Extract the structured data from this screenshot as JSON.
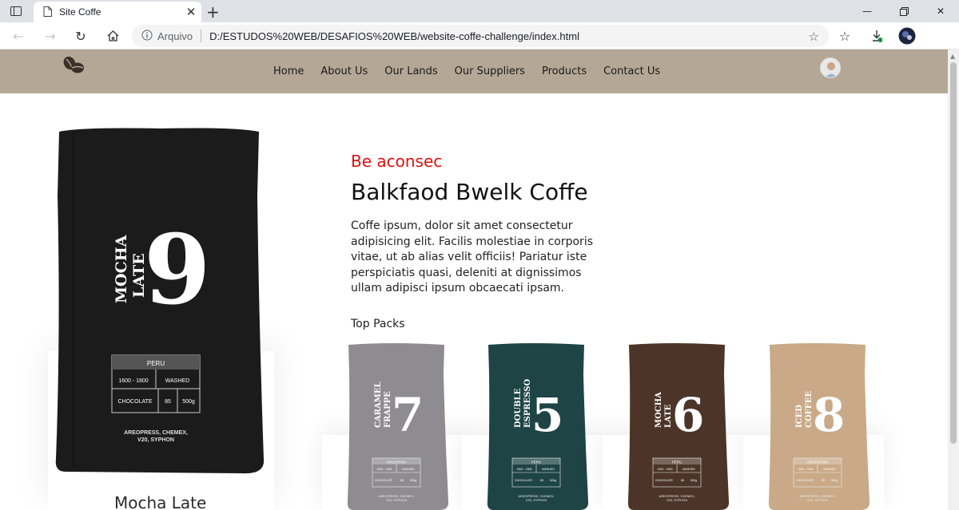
{
  "browser": {
    "tab_title": "Site Coffe",
    "url_label": "Arquivo",
    "url": "D:/ESTUDOS%20WEB/DESAFIOS%20WEB/website-coffe-challenge/index.html"
  },
  "nav": {
    "items": [
      "Home",
      "About Us",
      "Our Lands",
      "Our Suppliers",
      "Products",
      "Contact Us"
    ]
  },
  "hero": {
    "bag": {
      "brand_line1": "MOCHA",
      "brand_line2": "LATE",
      "number": "9",
      "origin": "PERU",
      "altitude": "1600 - 1800",
      "process": "WASHED",
      "flavor": "CHOCOLATE",
      "score": "85",
      "weight": "500g",
      "methods_line1": "AREOPRESS, CHEMEX,",
      "methods_line2": "V20, SYPHON"
    },
    "name": "Mocha Late"
  },
  "content": {
    "eyebrow": "Be aconsec",
    "title": "Balkfaod Bwelk Coffe",
    "paragraph": "Coffe ipsum, dolor sit amet consectetur adipisicing elit. Facilis molestiae in corporis vitae, ut ab alias velit officiis! Pariatur iste perspiciatis quasi, deleniti at dignissimos ullam adipisci ipsum obcaecati ipsam.",
    "section_label": "Top Packs"
  },
  "packs": [
    {
      "line1": "CARAMEL",
      "line2": "FRAPPE",
      "number": "7",
      "origin": "ARGENTINA",
      "color": "#8e8c91"
    },
    {
      "line1": "DOUBLE",
      "line2": "ESPRESSO",
      "number": "5",
      "origin": "PERU",
      "color": "#1f4446"
    },
    {
      "line1": "MOCHA",
      "line2": "LATE",
      "number": "6",
      "origin": "PERU",
      "color": "#4c3528"
    },
    {
      "line1": "ICED",
      "line2": "COFFEE",
      "number": "8",
      "origin": "ARGENTINA",
      "color": "#c9a987"
    }
  ],
  "pack_table": {
    "altitude": "1900 - 1800",
    "process": "WASHED",
    "flavor": "CHOCOLATE",
    "score": "85",
    "weight": "500g",
    "methods_line1": "AREOPRESS, CHEMEX,",
    "methods_line2": "V20, SYPHON"
  },
  "colors": {
    "header_bg": "#b4a795",
    "accent_red": "#e01010"
  },
  "icons": [
    "sidebar-toggle-icon",
    "page-icon",
    "close-icon",
    "plus-icon",
    "minimize-icon",
    "restore-icon",
    "back-icon",
    "forward-icon",
    "reload-icon",
    "home-icon",
    "info-icon",
    "favorite-add-icon",
    "favorites-icon",
    "downloads-icon",
    "profile-icon",
    "coffee-beans-logo"
  ]
}
